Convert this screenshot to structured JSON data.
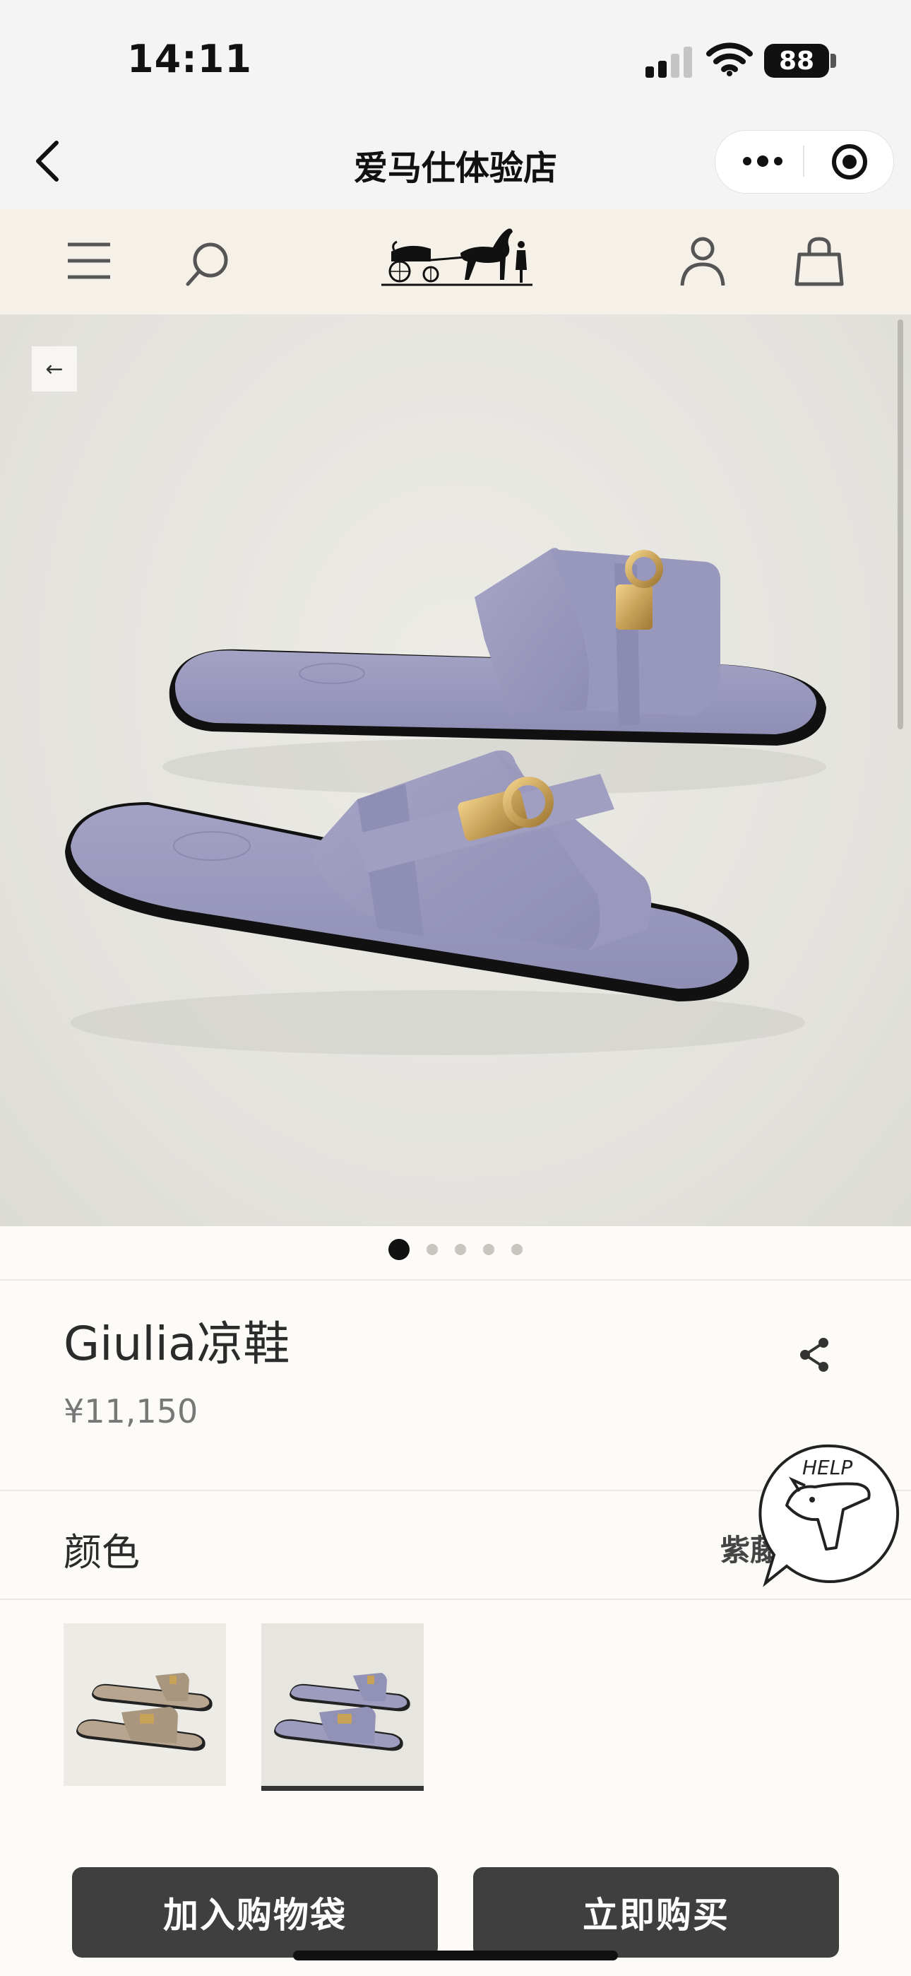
{
  "status_bar": {
    "time": "14:11",
    "battery": "88"
  },
  "nav": {
    "title": "爱马仕体验店"
  },
  "product": {
    "title": "Giulia凉鞋",
    "price": "¥11,150",
    "image_count": 5,
    "active_image": 1
  },
  "color": {
    "label": "颜色",
    "value": "紫藤"
  },
  "swatches": [
    {
      "name": "taupe",
      "selected": false
    },
    {
      "name": "lilac",
      "selected": true
    }
  ],
  "help": {
    "label": "HELP"
  },
  "actions": {
    "add_to_bag": "加入购物袋",
    "buy_now": "立即购买"
  },
  "colors": {
    "header_bg": "#f5f1e9",
    "page_bg": "#fdfbf7",
    "button_bg": "#3f3f3f",
    "sandal_lilac": "#9d9cbf",
    "hardware_gold": "#c9a25a"
  }
}
